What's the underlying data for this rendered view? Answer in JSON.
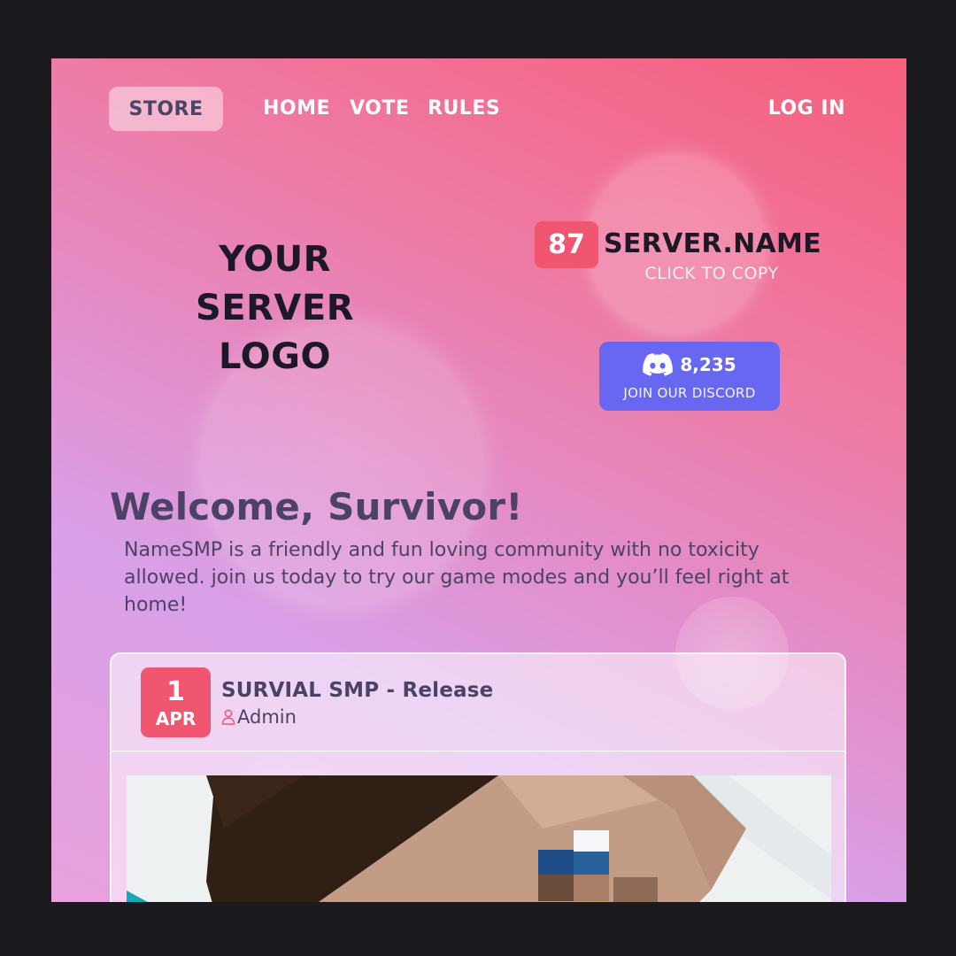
{
  "nav": {
    "store": "STORE",
    "home": "HOME",
    "vote": "VOTE",
    "rules": "RULES",
    "login": "LOG IN"
  },
  "logo": {
    "line1": "YOUR",
    "line2": "SERVER",
    "line3": "LOGO"
  },
  "server": {
    "player_count": "87",
    "name": "SERVER.NAME",
    "copy_hint": "CLICK TO COPY"
  },
  "discord": {
    "count": "8,235",
    "label": "JOIN OUR DISCORD",
    "icon": "discord-icon"
  },
  "welcome": {
    "title": "Welcome, Survivor!",
    "text": "NameSMP is a friendly and fun loving community with no toxicity allowed. join us today to try our game modes and you’ll feel right at home!"
  },
  "news": [
    {
      "day": "1",
      "month": "APR",
      "title": "SURVIAL SMP - Release",
      "author": "Admin",
      "author_icon": "user-icon"
    }
  ],
  "colors": {
    "accent": "#f0566f",
    "discord": "#6767f2",
    "text_dark": "#4c4266"
  }
}
